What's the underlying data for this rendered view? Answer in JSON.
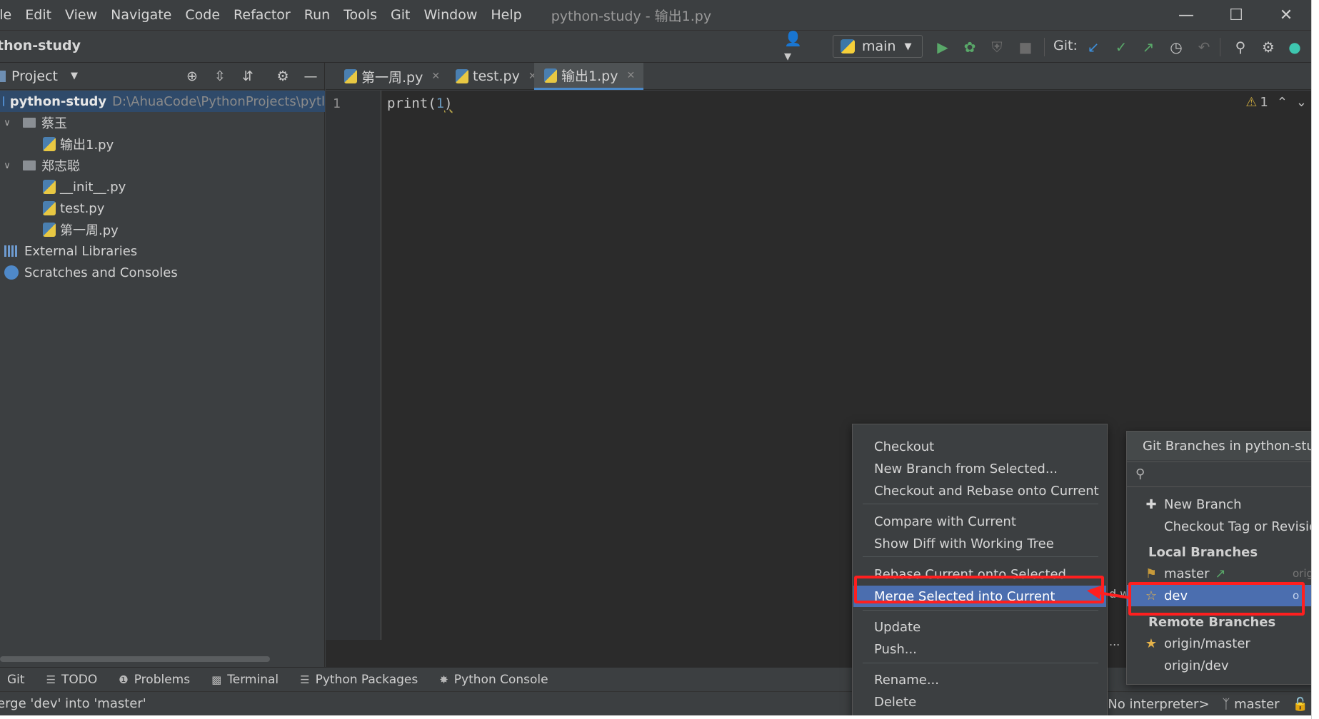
{
  "menubar": {
    "items": [
      "ile",
      "Edit",
      "View",
      "Navigate",
      "Code",
      "Refactor",
      "Run",
      "Tools",
      "Git",
      "Window",
      "Help"
    ],
    "window_title": "python-study - 输出1.py"
  },
  "toolbar": {
    "project_name": "thon-study",
    "branch": "main",
    "git_label": "Git:"
  },
  "project_panel": {
    "title": "Project",
    "root": {
      "name": "python-study",
      "path": "D:\\AhuaCode\\PythonProjects\\pytl"
    },
    "tree": [
      {
        "label": "蔡玉",
        "kind": "folder"
      },
      {
        "label": "输出1.py",
        "kind": "file"
      },
      {
        "label": "郑志聪",
        "kind": "folder"
      },
      {
        "label": "__init__.py",
        "kind": "file"
      },
      {
        "label": "test.py",
        "kind": "file"
      },
      {
        "label": "第一周.py",
        "kind": "file"
      },
      {
        "label": "External Libraries",
        "kind": "libs"
      },
      {
        "label": "Scratches and Consoles",
        "kind": "scratch"
      }
    ]
  },
  "editor": {
    "tabs": [
      {
        "label": "第一周.py",
        "active": false
      },
      {
        "label": "test.py",
        "active": false
      },
      {
        "label": "输出1.py",
        "active": true
      }
    ],
    "line_number": "1",
    "code": {
      "fn": "print(",
      "arg": "1",
      "close": ")"
    },
    "warning_count": "1"
  },
  "tool_windows": [
    "Git",
    "TODO",
    "Problems",
    "Terminal",
    "Python Packages",
    "Python Console"
  ],
  "status": {
    "message": "erge 'dev' into 'master'",
    "interpreter": "No interpreter>",
    "branch": "master"
  },
  "context_menu": {
    "groups": [
      [
        "Checkout",
        "New Branch from Selected...",
        "Checkout and Rebase onto Current"
      ],
      [
        "Compare with Current",
        "Show Diff with Working Tree"
      ],
      [
        "Rebase Current onto Selected",
        "Merge Selected into Current"
      ],
      [
        "Update",
        "Push..."
      ],
      [
        "Rename...",
        "Delete"
      ]
    ],
    "highlighted": "Merge Selected into Current"
  },
  "branches_popup": {
    "title": "Git Branches in python-study",
    "actions": [
      "New Branch",
      "Checkout Tag or Revision"
    ],
    "local_header": "Local Branches",
    "local": [
      {
        "name": "master",
        "tracking": "origi"
      },
      {
        "name": "dev",
        "tracking": "o"
      }
    ],
    "remote_header": "Remote Branches",
    "remote": [
      "origin/master",
      "origin/dev"
    ]
  },
  "partial_texts": {
    "behind_menu": "d w",
    "behind_menu_dots": "..."
  },
  "colors": {
    "accent": "#4b6eaf",
    "annotation_red": "#ff1f1f",
    "run_green": "#59a869"
  }
}
